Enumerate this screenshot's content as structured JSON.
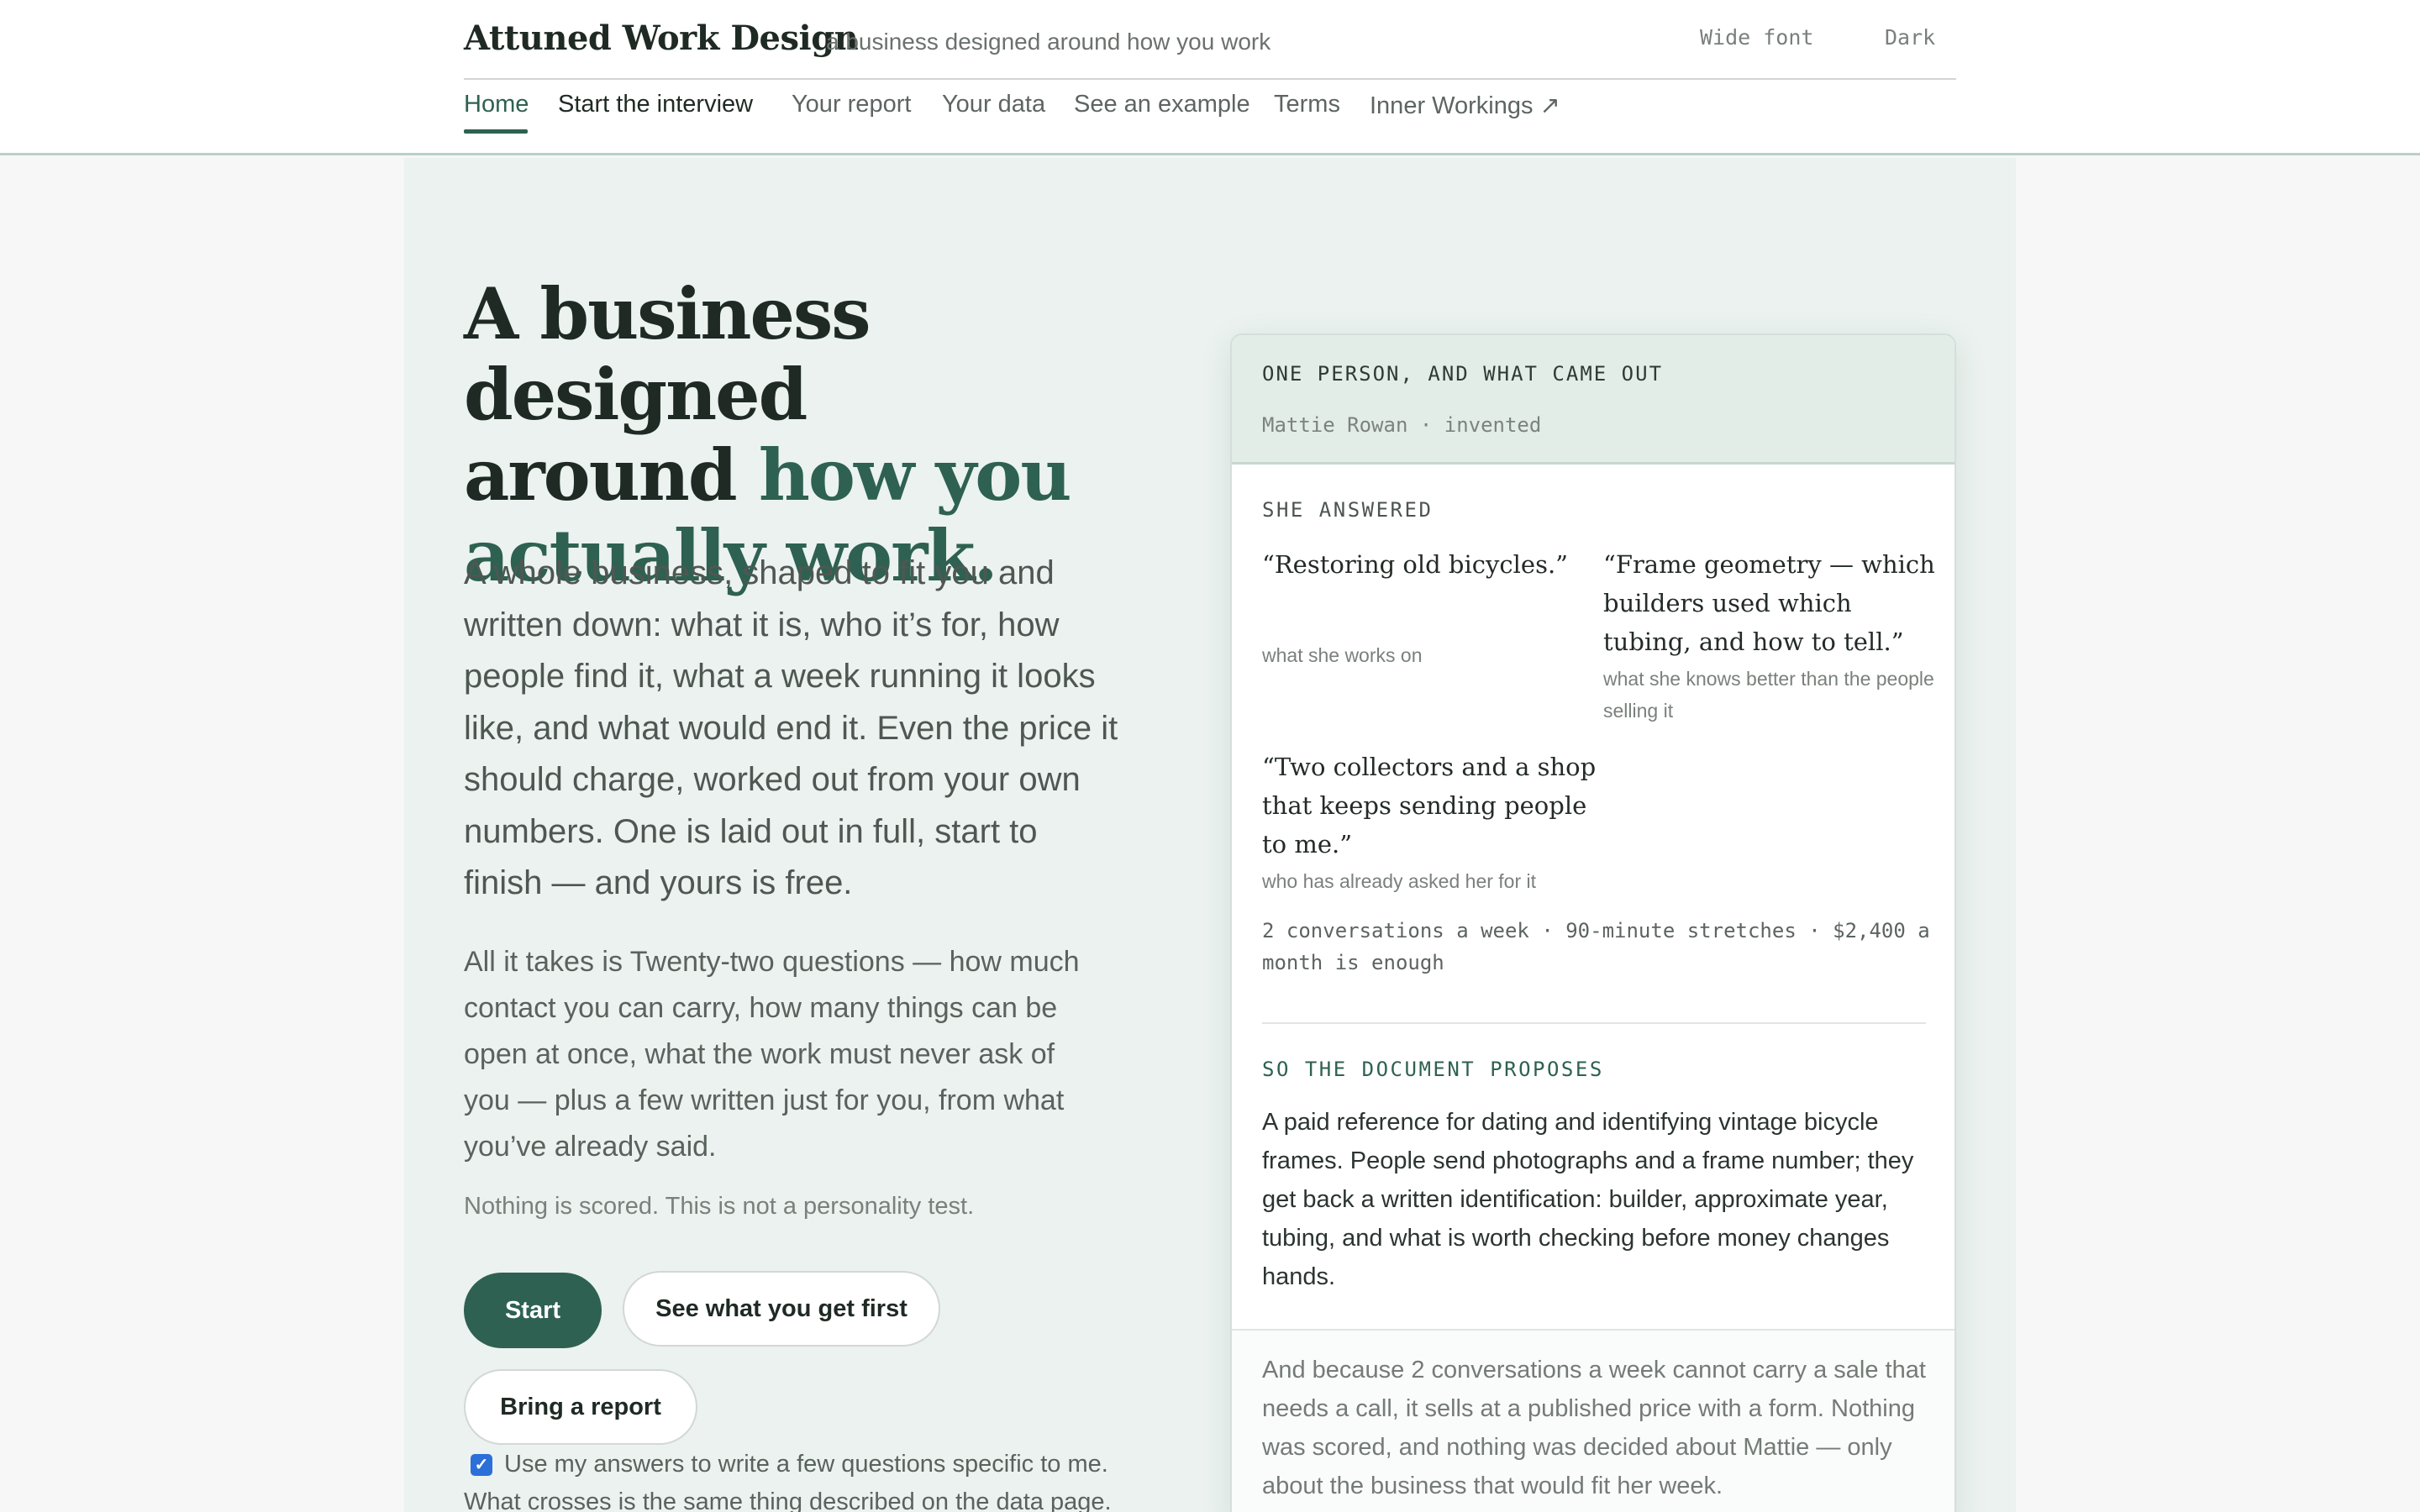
{
  "header": {
    "brand": "Attuned Work Design",
    "tagline": "a business designed around how you work",
    "wide_font": "Wide font",
    "dark": "Dark",
    "nav": [
      {
        "label": "Home"
      },
      {
        "label": "Start the interview"
      },
      {
        "label": "Your report"
      },
      {
        "label": "Your data"
      },
      {
        "label": "See an example"
      },
      {
        "label": "Terms"
      },
      {
        "label": "Inner Workings ↗"
      }
    ]
  },
  "hero": {
    "title_line1": "A business designed",
    "title_line2_plain": "around ",
    "title_line2_accent": "how you",
    "title_line3_accent": "actually work.",
    "lead": "A whole business, shaped to fit you and written down: what it is, who it’s for, how people find it, what a week running it looks like, and what would end it. Even the price it should charge, worked out from your own numbers. One is laid out in full, start to finish — and yours is free.",
    "sub": "All it takes is Twenty-two questions — how much contact you can carry, how many things can be open at once, what the work must never ask of you — plus a few written just for you, from what you’ve already said.",
    "note": "Nothing is scored. This is not a personality test.",
    "start": "Start",
    "see_first": "See what you get first",
    "bring_report": "Bring a report",
    "checkbox_label": "Use my answers to write a few questions specific to me.",
    "cut_text": "What crosses is the same thing described on the data page."
  },
  "card": {
    "kicker": "ONE PERSON, AND WHAT CAME OUT",
    "person": "Mattie Rowan · invented",
    "answered_label": "SHE ANSWERED",
    "answers": [
      {
        "quote": "“Restoring old bicycles.”",
        "caption": "what she works on"
      },
      {
        "quote": "“Frame geometry — which builders used which tubing, and how to tell.”",
        "caption": "what she knows better than the people selling it"
      },
      {
        "quote": "“Two collectors and a shop that keeps sending people to me.”",
        "caption": "who has already asked her for it"
      }
    ],
    "facts": "2 conversations a week · 90-minute stretches · $2,400 a month is enough",
    "proposes_label": "SO THE DOCUMENT PROPOSES",
    "proposal": "A paid reference for dating and identifying vintage bicycle frames. People send photographs and a frame number; they get back a written identification: builder, approximate year, tubing, and what is worth checking before money changes hands.",
    "footer": "And because 2 conversations a week cannot carry a sale that needs a call, it sells at a published price with a form. Nothing was scored, and nothing was decided about Mattie — only about the business that would fit her week."
  },
  "colors": {
    "accent": "#2e6151",
    "page_bg": "#ebf2ef",
    "card_head_bg": "#e2ede8",
    "checkbox": "#2d6fd8"
  }
}
